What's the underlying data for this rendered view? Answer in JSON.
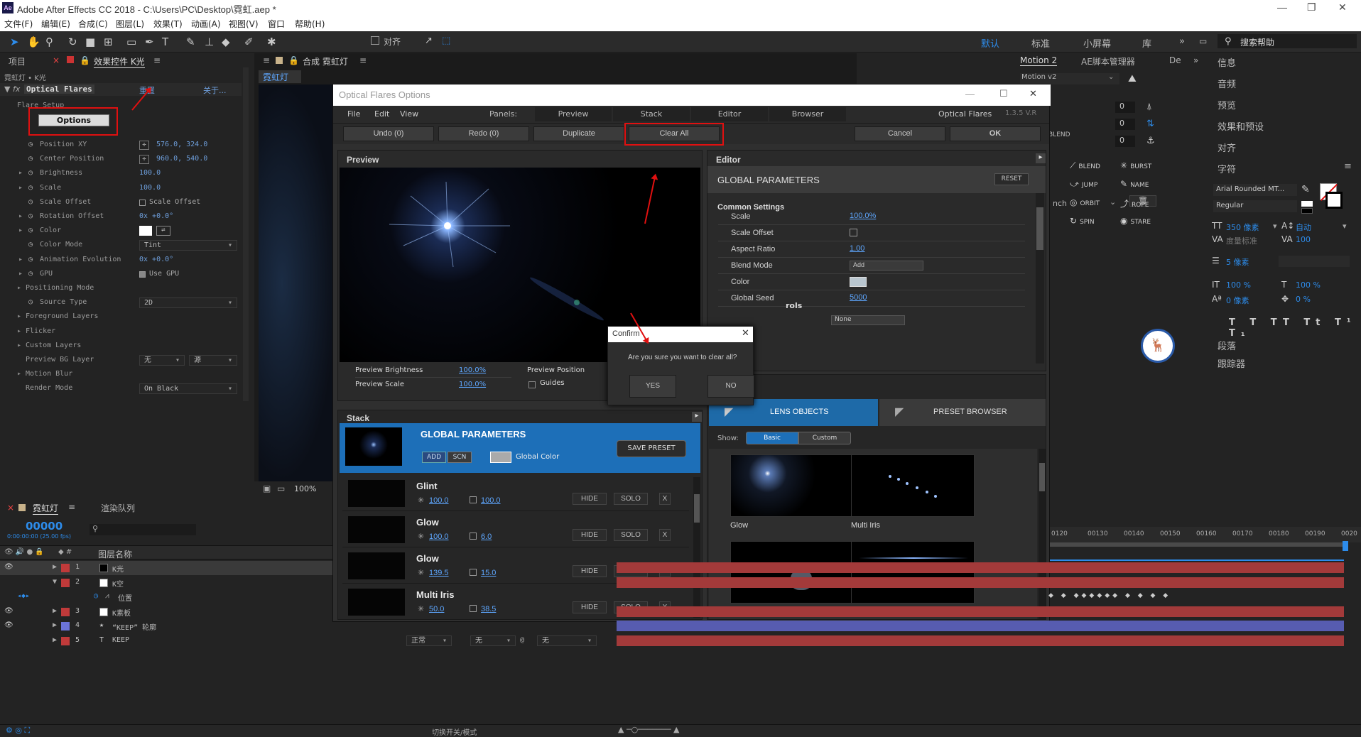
{
  "window": {
    "title": "Adobe After Effects CC 2018 - C:\\Users\\PC\\Desktop\\霓虹.aep *",
    "app_icon": "Ae"
  },
  "menu": [
    "文件(F)",
    "编辑(E)",
    "合成(C)",
    "图层(L)",
    "效果(T)",
    "动画(A)",
    "视图(V)",
    "窗口",
    "帮助(H)"
  ],
  "toolbar": {
    "align_label": "对齐",
    "workspaces": [
      "默认",
      "标准",
      "小屏幕",
      "库"
    ],
    "search_placeholder": "搜索帮助"
  },
  "left_panel": {
    "tabs": [
      "项目",
      "效果控件 K光"
    ],
    "breadcrumb": "霓虹灯 • K光",
    "effect_name": "Optical Flares",
    "reset": "重置",
    "about": "关于...",
    "flare_setup": "Flare Setup",
    "options_button": "Options",
    "rows": [
      {
        "label": "Position XY",
        "value": "576.0, 324.0"
      },
      {
        "label": "Center Position",
        "value": "960.0, 540.0"
      },
      {
        "label": "Brightness",
        "value": "100.0"
      },
      {
        "label": "Scale",
        "value": "100.0"
      },
      {
        "label": "Scale Offset",
        "value": "Scale Offset"
      },
      {
        "label": "Rotation Offset",
        "value": "0x +0.0°"
      },
      {
        "label": "Color",
        "value": ""
      },
      {
        "label": "Color Mode",
        "value": "Tint"
      },
      {
        "label": "Animation Evolution",
        "value": "0x +0.0°"
      },
      {
        "label": "GPU",
        "value": "Use GPU"
      },
      {
        "label": "Positioning Mode",
        "value": ""
      },
      {
        "label": "Source Type",
        "value": "2D"
      },
      {
        "label": "Foreground Layers",
        "value": ""
      },
      {
        "label": "Flicker",
        "value": ""
      },
      {
        "label": "Custom Layers",
        "value": ""
      },
      {
        "label": "Preview BG Layer",
        "value": "无"
      },
      {
        "label": "Motion Blur",
        "value": ""
      },
      {
        "label": "Render Mode",
        "value": "On Black"
      }
    ],
    "preview_bg_second": "源"
  },
  "comp_panel": {
    "tab": "合成 霓虹灯",
    "subtab": "霓虹灯",
    "zoom": "100%"
  },
  "dialog": {
    "title": "Optical Flares Options",
    "menu": [
      "File",
      "Edit",
      "View"
    ],
    "panels_label": "Panels:",
    "panel_tabs": [
      "Preview",
      "Stack",
      "Editor",
      "Browser"
    ],
    "brand": "Optical Flares",
    "version": "1.3.5 V.R",
    "buttons": {
      "undo": "Undo (0)",
      "redo": "Redo (0)",
      "duplicate": "Duplicate",
      "clear_all": "Clear All",
      "cancel": "Cancel",
      "ok": "OK"
    },
    "preview": {
      "header": "Preview",
      "brightness_label": "Preview Brightness",
      "brightness": "100.0%",
      "scale_label": "Preview Scale",
      "scale": "100.0%",
      "position_label": "Preview Position",
      "guides_label": "Guides"
    },
    "editor": {
      "header": "Editor",
      "section": "GLOBAL PARAMETERS",
      "reset": "RESET",
      "common": "Common Settings",
      "params": [
        {
          "label": "Scale",
          "value": "100.0%"
        },
        {
          "label": "Scale Offset",
          "value": ""
        },
        {
          "label": "Aspect Ratio",
          "value": "1.00"
        },
        {
          "label": "Blend Mode",
          "value": "Add"
        },
        {
          "label": "Color",
          "value": ""
        },
        {
          "label": "Global Seed",
          "value": "5000"
        }
      ],
      "partial": "rols",
      "none_select": "None"
    },
    "stack": {
      "header": "Stack",
      "global": "GLOBAL PARAMETERS",
      "add": "ADD",
      "scn": "SCN",
      "global_color": "Global Color",
      "save_preset": "SAVE PRESET",
      "hide": "HIDE",
      "solo": "SOLO",
      "x": "X",
      "rows": [
        {
          "name": "Glint",
          "v1": "100.0",
          "v2": "100.0"
        },
        {
          "name": "Glow",
          "v1": "100.0",
          "v2": "6.0"
        },
        {
          "name": "Glow",
          "v1": "139.5",
          "v2": "15.0"
        },
        {
          "name": "Multi Iris",
          "v1": "50.0",
          "v2": "38.5"
        }
      ]
    },
    "browser": {
      "tab_lens": "LENS OBJECTS",
      "tab_preset": "PRESET BROWSER",
      "show_label": "Show:",
      "basic": "Basic",
      "custom": "Custom",
      "items": [
        "Glow",
        "Multi Iris",
        "",
        ""
      ]
    },
    "lens_icons": [
      "BLEND",
      "BURST",
      "JUMP",
      "NAME",
      "ORBIT",
      "ROPE",
      "SPIN",
      "STARE"
    ]
  },
  "confirm": {
    "title": "Confirm",
    "message": "Are you sure you want to clear all?",
    "yes": "YES",
    "no": "NO"
  },
  "right_panel": {
    "motion_tab": "Motion 2",
    "ae_script": "AE脚本管理器",
    "de": "De",
    "motion_select": "Motion v2",
    "num": [
      "0",
      "0",
      "0"
    ],
    "nch": "nch",
    "items": [
      "信息",
      "音频",
      "预览",
      "效果和预设",
      "对齐",
      "字符"
    ],
    "font": "Arial Rounded MT...",
    "style": "Regular",
    "char_rows": {
      "size": "350 像素",
      "leading": "自动",
      "tracking_label": "度量标准",
      "tracking": "100",
      "stroke": "5 像素",
      "vscale": "100 %",
      "hscale": "100 %",
      "baseline": "0 像素",
      "tsume": "0 %"
    },
    "items2": [
      "段落",
      "跟踪器"
    ]
  },
  "timeline": {
    "tab": "霓虹灯",
    "render": "渲染队列",
    "timecode": "00000",
    "fps": "0:00:00:00 (25.00 fps)",
    "col_name": "图层名称",
    "layers": [
      {
        "num": "1",
        "name": "K光"
      },
      {
        "num": "2",
        "name": "K空"
      },
      {
        "num": "",
        "name": "位置"
      },
      {
        "num": "3",
        "name": "K素板"
      },
      {
        "num": "4",
        "name": "“KEEP” 轮廓"
      },
      {
        "num": "5",
        "name": "KEEP"
      }
    ],
    "mode": "正常",
    "none": "无",
    "ruler": [
      "0120",
      "00130",
      "00140",
      "00150",
      "00160",
      "00170",
      "00180",
      "00190",
      "0020"
    ],
    "toggle": "切换开关/模式"
  },
  "colors": {
    "accent": "#2d8ceb",
    "lens_tab": "#1e6aa8",
    "highlight_red": "#e01010",
    "track_red": "#b03434",
    "track_blue": "#5a5fb0"
  }
}
